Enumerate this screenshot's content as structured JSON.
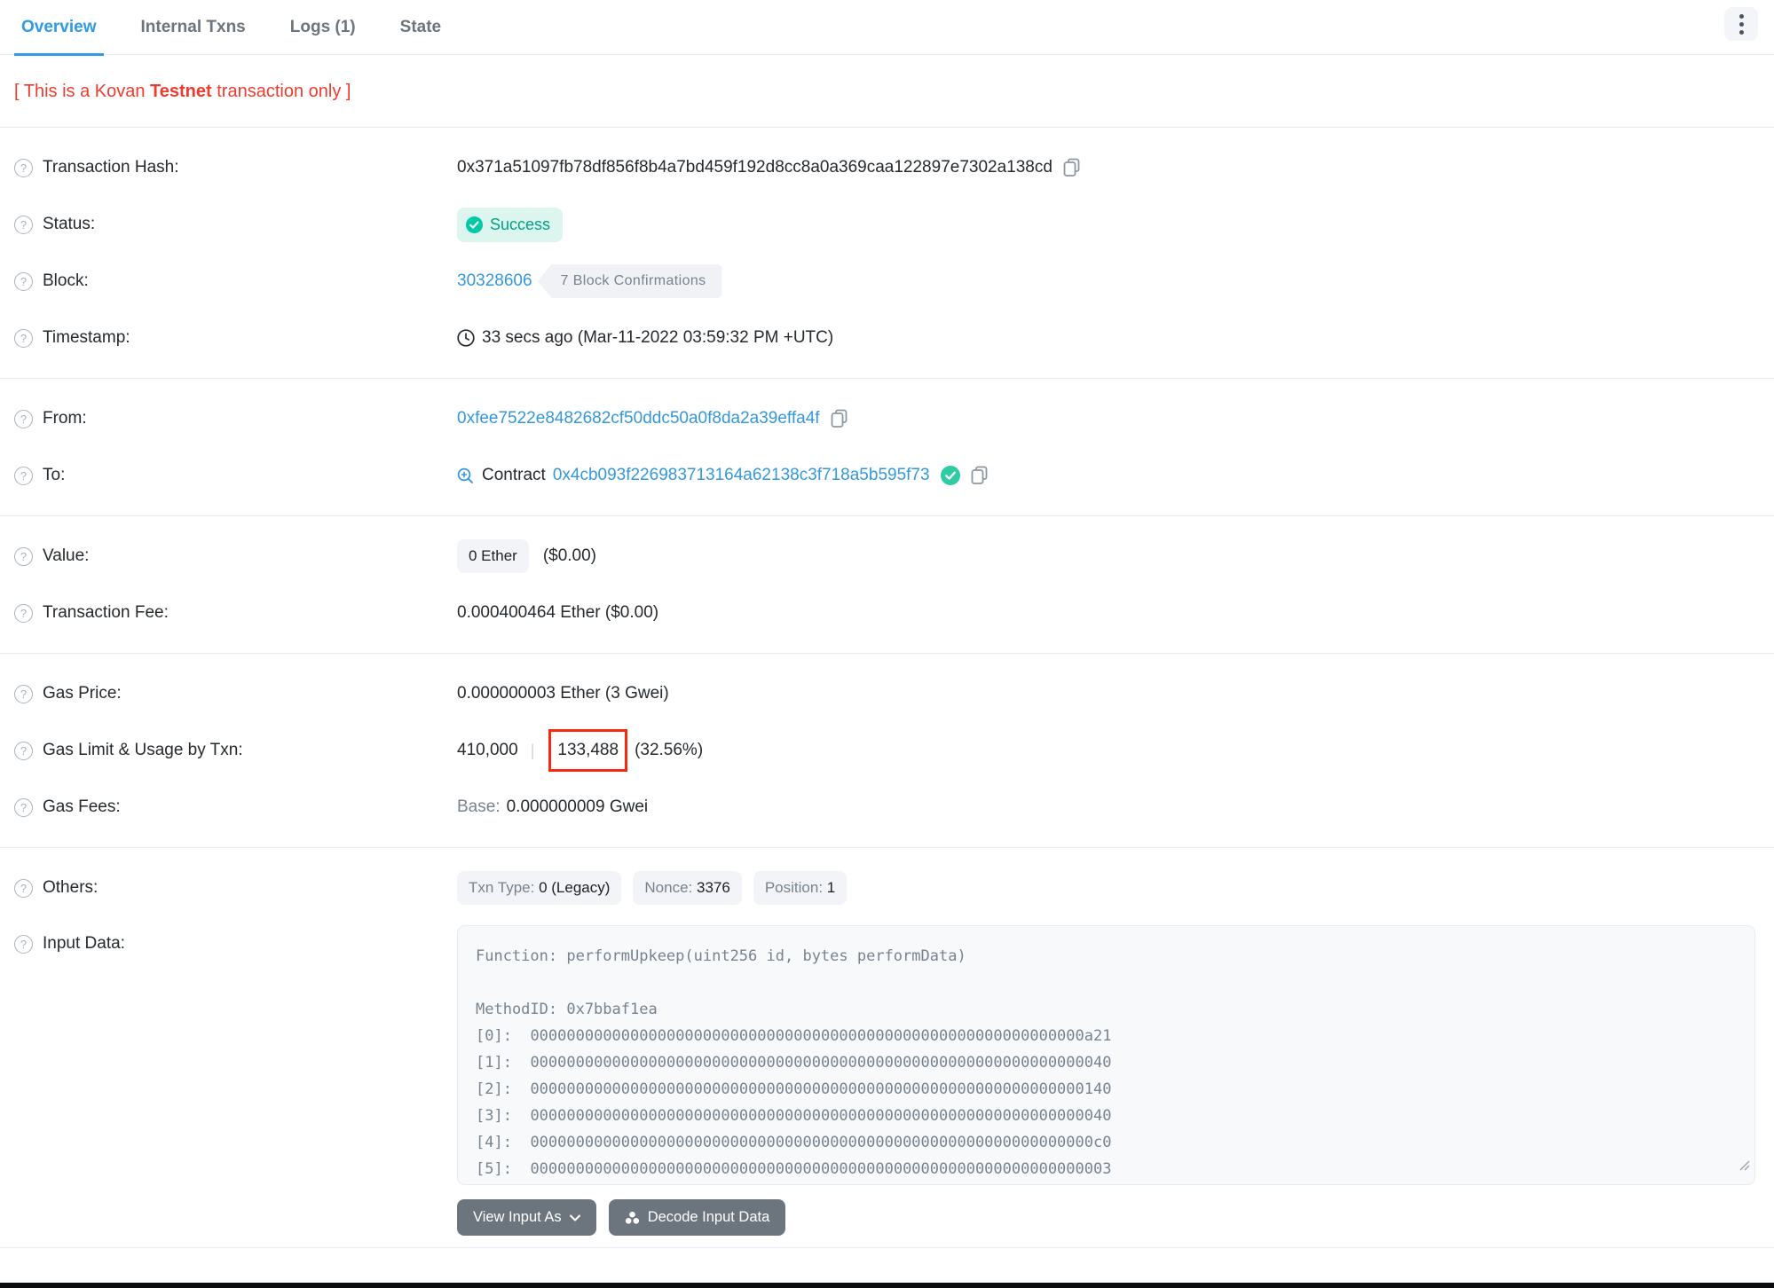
{
  "tabs": {
    "items": [
      {
        "label": "Overview",
        "active": true
      },
      {
        "label": "Internal Txns",
        "active": false
      },
      {
        "label": "Logs (1)",
        "active": false
      },
      {
        "label": "State",
        "active": false
      }
    ],
    "more_button_icon": "kebab-menu"
  },
  "notice": {
    "prefix": "[ This is a Kovan ",
    "bold": "Testnet",
    "suffix": " transaction only ]"
  },
  "rows": {
    "transaction_hash": {
      "label": "Transaction Hash:",
      "value": "0x371a51097fb78df856f8b4a7bd459f192d8cc8a0a369caa122897e7302a138cd"
    },
    "status": {
      "label": "Status:",
      "value": "Success"
    },
    "block": {
      "label": "Block:",
      "number": "30328606",
      "confirmations": "7 Block Confirmations"
    },
    "timestamp": {
      "label": "Timestamp:",
      "value": "33 secs ago (Mar-11-2022 03:59:32 PM +UTC)"
    },
    "from": {
      "label": "From:",
      "address": "0xfee7522e8482682cf50ddc50a0f8da2a39effa4f"
    },
    "to": {
      "label": "To:",
      "contract_word": "Contract",
      "address": "0x4cb093f226983713164a62138c3f718a5b595f73"
    },
    "value": {
      "label": "Value:",
      "badge": "0 Ether",
      "usd": "($0.00)"
    },
    "transaction_fee": {
      "label": "Transaction Fee:",
      "value": "0.000400464 Ether ($0.00)"
    },
    "gas_price": {
      "label": "Gas Price:",
      "value": "0.000000003 Ether (3 Gwei)"
    },
    "gas_limit_usage": {
      "label": "Gas Limit & Usage by Txn:",
      "limit": "410,000",
      "separator": "|",
      "usage": "133,488",
      "percent": "(32.56%)"
    },
    "gas_fees": {
      "label": "Gas Fees:",
      "base_label": "Base:",
      "base_value": "0.000000009 Gwei"
    },
    "others": {
      "label": "Others:",
      "badges": [
        {
          "name": "Txn Type:",
          "value": "0 (Legacy)"
        },
        {
          "name": "Nonce:",
          "value": "3376"
        },
        {
          "name": "Position:",
          "value": "1"
        }
      ]
    },
    "input_data": {
      "label": "Input Data:",
      "function_line": "Function: performUpkeep(uint256 id, bytes performData)",
      "method_line": "MethodID: 0x7bbaf1ea",
      "params": [
        {
          "index": "[0]:",
          "value": "0000000000000000000000000000000000000000000000000000000000000a21"
        },
        {
          "index": "[1]:",
          "value": "0000000000000000000000000000000000000000000000000000000000000040"
        },
        {
          "index": "[2]:",
          "value": "0000000000000000000000000000000000000000000000000000000000000140"
        },
        {
          "index": "[3]:",
          "value": "0000000000000000000000000000000000000000000000000000000000000040"
        },
        {
          "index": "[4]:",
          "value": "00000000000000000000000000000000000000000000000000000000000000c0"
        },
        {
          "index": "[5]:",
          "value": "0000000000000000000000000000000000000000000000000000000000000003"
        }
      ]
    }
  },
  "buttons": {
    "view_input_as": "View Input As",
    "decode_input_data": "Decode Input Data"
  },
  "colors": {
    "link_blue": "#3498db",
    "active_tab_blue": "#2f9be4",
    "notice_red": "#ee3b2e",
    "annotation_red": "#f52a0e",
    "success_text": "#00a186",
    "success_bg": "#dcf5ee",
    "success_icon": "#00c9a7",
    "muted_gray": "#77838f",
    "divider": "#e7eaf3",
    "button_gray": "#6c757d"
  }
}
